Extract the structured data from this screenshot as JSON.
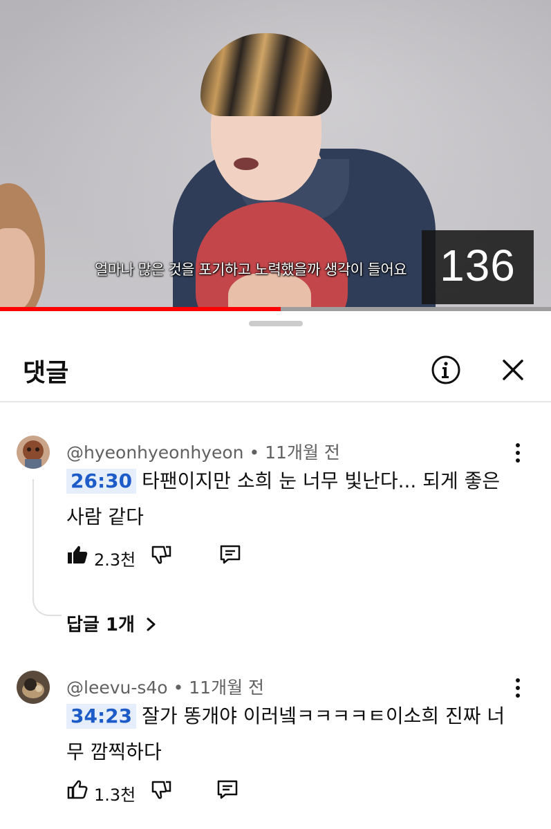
{
  "video": {
    "subtitle": "얼마나 많은 것을 포기하고 노력했을까 생각이 들어요",
    "counter": "136",
    "progress": 0.51
  },
  "comments_sheet": {
    "title": "댓글",
    "info_icon": "info-circle-icon",
    "close_icon": "close-icon"
  },
  "comments": [
    {
      "author": "@hyeonhyeonhyeon",
      "time": "11개월 전",
      "timestamp": "26:30",
      "text": "타팬이지만 소희 눈 너무 빛난다... 되게 좋은 사람 같다",
      "likes": "2.3천",
      "replies_label": "답글 1개"
    },
    {
      "author": "@leevu-s4o",
      "time": "11개월 전",
      "timestamp": "34:23",
      "text": "잘가 똥개야 이러넼ㅋㅋㅋㅋㅌ이소희 진짜 너무 깜찍하다",
      "likes": "1.3천"
    }
  ],
  "colors": {
    "timestamp_bg": "#e7eefb",
    "timestamp_text": "#1c5bc8",
    "progress": "#ff0000"
  }
}
